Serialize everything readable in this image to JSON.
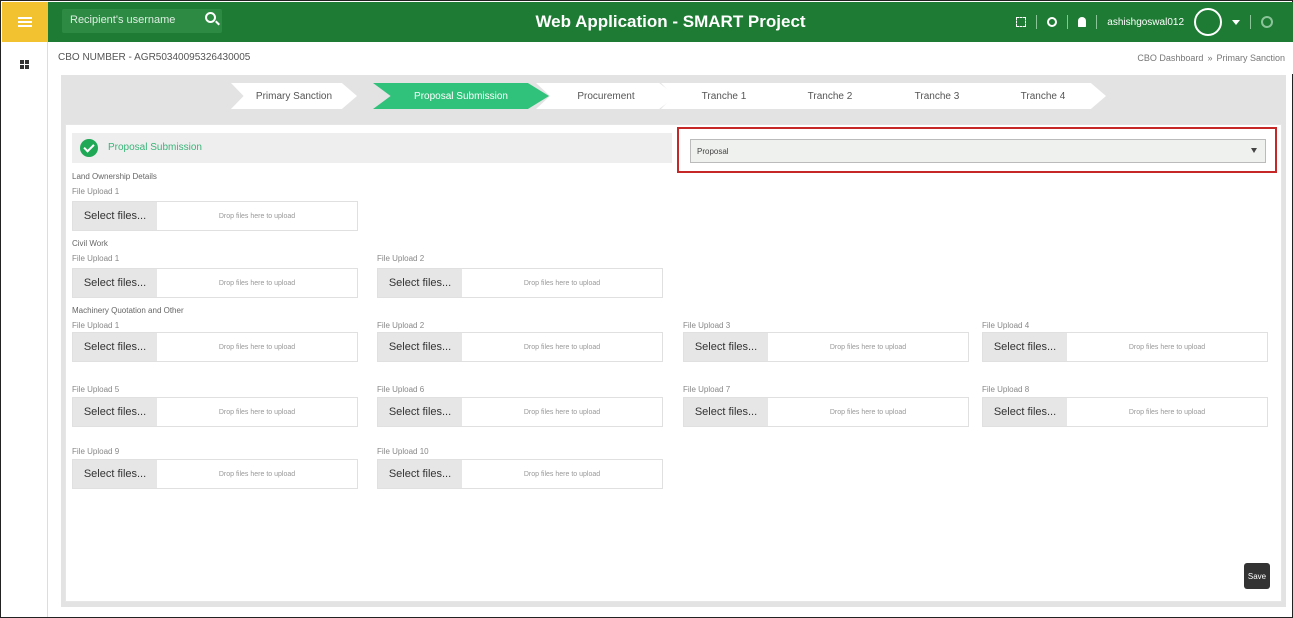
{
  "header": {
    "app_title": "Web Application - SMART Project",
    "search_placeholder": "Recipient's username",
    "username": "ashishgoswal012"
  },
  "subbar": {
    "cbo_number": "CBO NUMBER - AGR50340095326430005",
    "breadcrumb": [
      "CBO Dashboard",
      "»",
      "Primary Sanction"
    ]
  },
  "steps": [
    {
      "label": "Primary Sanction",
      "active": false
    },
    {
      "label": "Proposal Submission",
      "active": true
    },
    {
      "label": "Procurement",
      "active": false
    },
    {
      "label": "Tranche 1",
      "active": false
    },
    {
      "label": "Tranche 2",
      "active": false
    },
    {
      "label": "Tranche 3",
      "active": false
    },
    {
      "label": "Tranche 4",
      "active": false
    }
  ],
  "form": {
    "title": "Proposal Submission",
    "dropdown_value": "Proposal",
    "select_label": "Select files...",
    "drop_label": "Drop files here to upload",
    "sections": {
      "land": "Land Ownership Details",
      "civil": "Civil Work",
      "machinery": "Machinery Quotation and Other"
    },
    "file_labels": [
      "File Upload 1",
      "File Upload 2",
      "File Upload 3",
      "File Upload 4",
      "File Upload 5",
      "File Upload 6",
      "File Upload 7",
      "File Upload 8",
      "File Upload 9",
      "File Upload 10"
    ],
    "save_label": "Save"
  },
  "colors": {
    "header_green": "#1e7b34",
    "active_step": "#30c27a",
    "highlight_red": "#c62828",
    "menu_yellow": "#f2c230"
  }
}
